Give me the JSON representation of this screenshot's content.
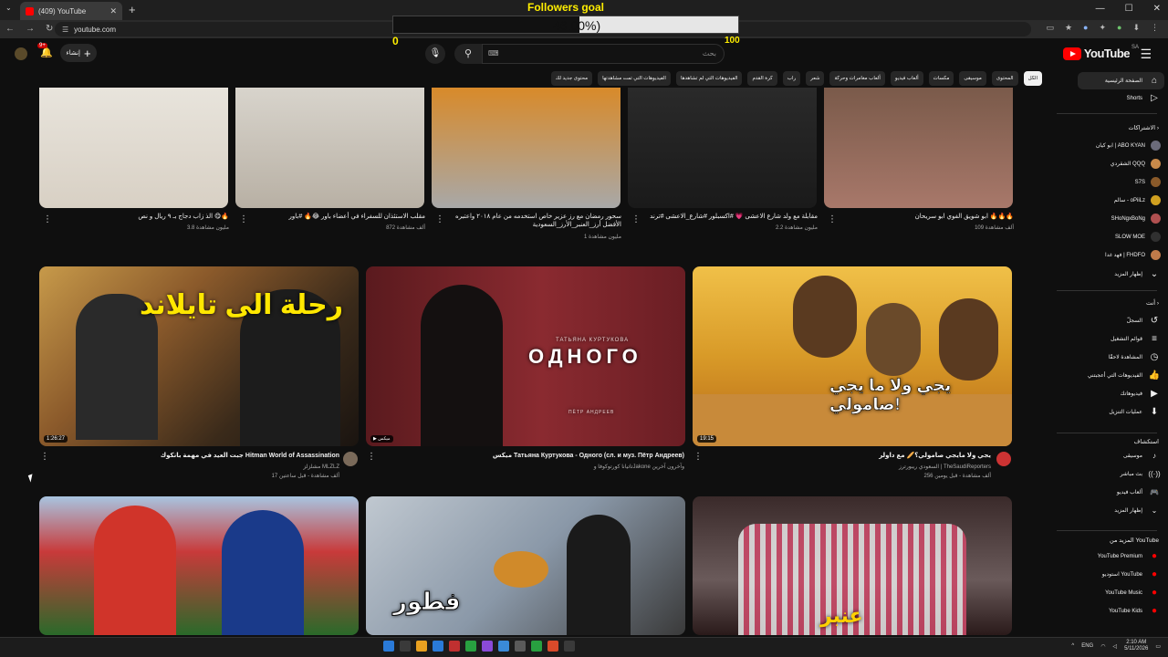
{
  "browser": {
    "tab_title": "(409) YouTube",
    "url": "youtube.com"
  },
  "overlay": {
    "title": "Followers goal",
    "percent_text": "46.00%)",
    "progress": 0.46,
    "min": "0",
    "max": "100"
  },
  "header": {
    "logo": "YouTube",
    "country": "SA",
    "search_placeholder": "بحث",
    "create_label": "إنشاء",
    "notif_badge": "9+"
  },
  "chips": [
    "الكل",
    "المحتوى",
    "موسيقى",
    "مكسات",
    "ألعاب فيديو",
    "ألعاب مغامرات وحركة",
    "شعر",
    "راب",
    "كرة القدم",
    "الفيديوهات التي لم تشاهدها",
    "الفيديوهات التي تمت مشاهدتها",
    "محتوى جديد لك"
  ],
  "sidebar": {
    "home": "الصفحة الرئيسية",
    "shorts": "Shorts",
    "subs_title": "الاشتراكات",
    "subs": [
      "ابو كيان | ABO KYAN",
      "الشقردي QQQ",
      "S7S",
      "سالم - oPiiLz",
      "SHoNgxBoNg",
      "SLOW MOE",
      "فهد غدا | FHDFO"
    ],
    "show_more": "إظهار المزيد",
    "you_title": "أنت",
    "you_items": [
      "السجلّ",
      "قوائم التشغيل",
      "المشاهدة لاحقًا",
      "الفيديوهات التي أعجبتني",
      "فيديوهاتك",
      "عمليات التنزيل"
    ],
    "explore_title": "استكشاف",
    "explore_items": [
      "موسيقى",
      "بث مباشر",
      "ألعاب فيديو",
      "إظهار المزيد"
    ],
    "more_title": "المزيد من YouTube",
    "more_items": [
      "YouTube Premium",
      "استوديو YouTube",
      "YouTube Music",
      "YouTube Kids"
    ]
  },
  "row1": [
    {
      "title": "الذ زاب دجاج بـ ٩ ريال و نص 😋🔥",
      "meta": "3.8 مليون مشاهدة"
    },
    {
      "title": "مقلب الاستئذان للسفراء في أعضاء باور 😂🔥 #باور",
      "meta": "872 ألف مشاهدة"
    },
    {
      "title": "سحور رمضان مع رز عزير خاص استخدمه من عام ٢٠١٨ واعتبره الأفضل أرز_العنبر_الأرز_السعودية",
      "meta": "1 مليون مشاهدة"
    },
    {
      "title": "مقابلة مع ولد شارع الاعشى 💗 #اكسبلور #شارع_الاعشى #ترند",
      "meta": "2.2 مليون مشاهدة"
    },
    {
      "title": "ابو شويق الفوي ابو سريحان 🔥🔥🔥",
      "meta": "109 ألف مشاهدة"
    }
  ],
  "row2": [
    {
      "title": "جبت العيد في مهمة بانكوك Hitman World of Assassination",
      "channel": "مشلزلز MLZLZ",
      "meta": "17 ألف مشاهدة - قبل ساعتين",
      "duration": "1:26:27",
      "thumb_text": "رحلة الى تايلاند"
    },
    {
      "title": "ميكس Татьяна Куртукова - Одного (сл. и муз. Пётр Андреев)",
      "channel": "تاتيانا كورتوكوفا وJakone وآخرون آخرين",
      "meta": "",
      "mix_label": "ميكس",
      "thumb_artist": "ТАТЬЯНА КУРТУКОВА",
      "thumb_title": "ОДНОГО",
      "thumb_sub": "ПЁТР АНДРЕЕВ"
    },
    {
      "title": "يجي ولا مايجي صامولي؟🥖 مع داولر",
      "channel": "السعودي ريبورترز | TheSaudiReporters",
      "meta": "256 ألف مشاهدة - قبل يومين",
      "duration": "19:15",
      "thumb_text": "يجي ولا ما يجي صامولي!"
    }
  ],
  "row3": [
    {
      "thumb_text": ""
    },
    {
      "thumb_text": "فطور"
    },
    {
      "thumb_text": "عنبر"
    }
  ],
  "taskbar": {
    "lang": "ENG",
    "time": "2:10 AM",
    "date": "5/11/2026"
  },
  "colors": {
    "bg": "#0f0f0f",
    "accent": "#ff0000",
    "overlay": "#ffee00"
  }
}
